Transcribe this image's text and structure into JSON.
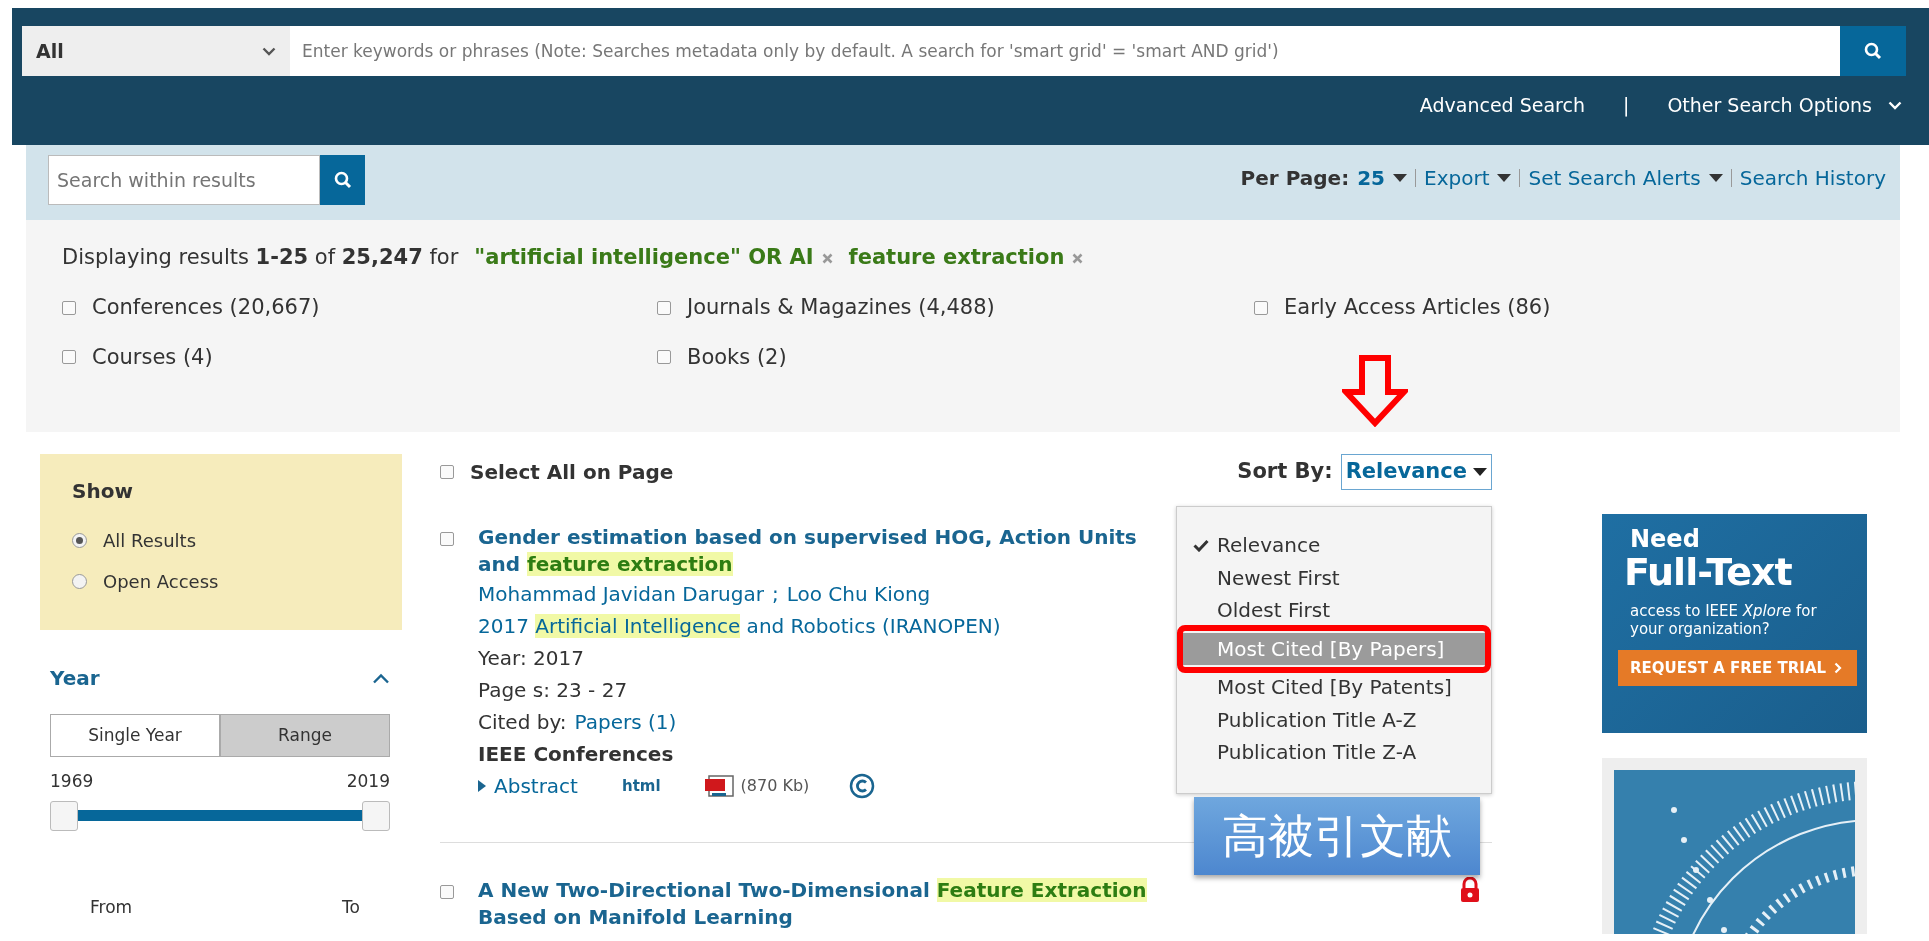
{
  "search_bar": {
    "scope": "All",
    "placeholder": "Enter keywords or phrases (Note: Searches metadata only by default. A search for 'smart grid' = 'smart AND grid')",
    "links": [
      "Advanced Search",
      "Other Search Options"
    ],
    "separator": "|"
  },
  "toolbar": {
    "within_placeholder": "Search within results",
    "per_page_label": "Per Page:",
    "per_page_value": "25",
    "links": [
      "Export",
      "Set Search Alerts",
      "Search History"
    ]
  },
  "summary": {
    "text": "Displaying results **1-25** of **25,247** for",
    "terms": [
      "\"artificial intelligence\" OR AI",
      "feature extraction"
    ]
  },
  "filters": [
    {
      "label": "Conferences (20,667)",
      "checked": false
    },
    {
      "label": "Journals & Magazines (4,488)",
      "checked": false
    },
    {
      "label": "Early Access Articles (86)",
      "checked": false
    },
    {
      "label": "Courses (4)",
      "checked": false
    },
    {
      "label": "Books (2)",
      "checked": false
    }
  ],
  "sidebar": {
    "show_title": "Show",
    "show_options": [
      {
        "label": "All Results",
        "selected": true
      },
      {
        "label": "Open Access",
        "selected": false
      }
    ],
    "year": {
      "title": "Year",
      "expanded": true,
      "modes": [
        {
          "label": "Single Year",
          "selected": false
        },
        {
          "label": "Range",
          "selected": true
        }
      ],
      "min": "1969",
      "max": "2019",
      "from_label": "From",
      "to_label": "To"
    }
  },
  "results_header": {
    "select_all": "Select All on Page",
    "checked": false,
    "sort_label": "Sort By:",
    "sort_value": "Relevance"
  },
  "sort_menu": [
    {
      "label": "Relevance",
      "selected": true,
      "highlighted": false
    },
    {
      "label": "Newest First",
      "selected": false,
      "highlighted": false
    },
    {
      "label": "Oldest First",
      "selected": false,
      "highlighted": false
    },
    {
      "label": "Most Cited [By Papers]",
      "selected": false,
      "highlighted": true
    },
    {
      "label": "Most Cited [By Patents]",
      "selected": false,
      "highlighted": false
    },
    {
      "label": "Publication Title A-Z",
      "selected": false,
      "highlighted": false
    },
    {
      "label": "Publication Title Z-A",
      "selected": false,
      "highlighted": false
    }
  ],
  "results": [
    {
      "checked": false,
      "locked": false,
      "title": [
        {
          "text": "Gender estimation based on supervised HOG, Action Units and ",
          "highlight": false
        },
        {
          "text": "feature extraction",
          "highlight": true
        }
      ],
      "authors": [
        "Mohammad Javidan Darugar",
        "Loo Chu Kiong"
      ],
      "author_separator": ";",
      "publication": [
        {
          "text": "2017 ",
          "highlight": false
        },
        {
          "text": "Artificial Intelligence",
          "highlight": true
        },
        {
          "text": " and Robotics (IRANOPEN)",
          "highlight": false
        }
      ],
      "year": "Year: 2017",
      "pages": "Page s: 23 - 27",
      "cited_label": "Cited by:",
      "cited_link": "Papers (1)",
      "type": "IEEE Conferences",
      "abstract": "Abstract",
      "html_label": "html",
      "pdf_size": "(870 Kb)"
    },
    {
      "checked": false,
      "locked": true,
      "title": [
        {
          "text": "A New Two-Directional Two-Dimensional ",
          "highlight": false
        },
        {
          "text": "Feature Extraction",
          "highlight": true
        },
        {
          "text": " Based on Manifold Learning",
          "highlight": false
        }
      ]
    }
  ],
  "ad": {
    "line1": "Need",
    "line2": "Full-Text",
    "line3": "access to IEEE *Xplore* for your organization?",
    "cta": "REQUEST A FREE TRIAL"
  },
  "callout": "高被引文献"
}
